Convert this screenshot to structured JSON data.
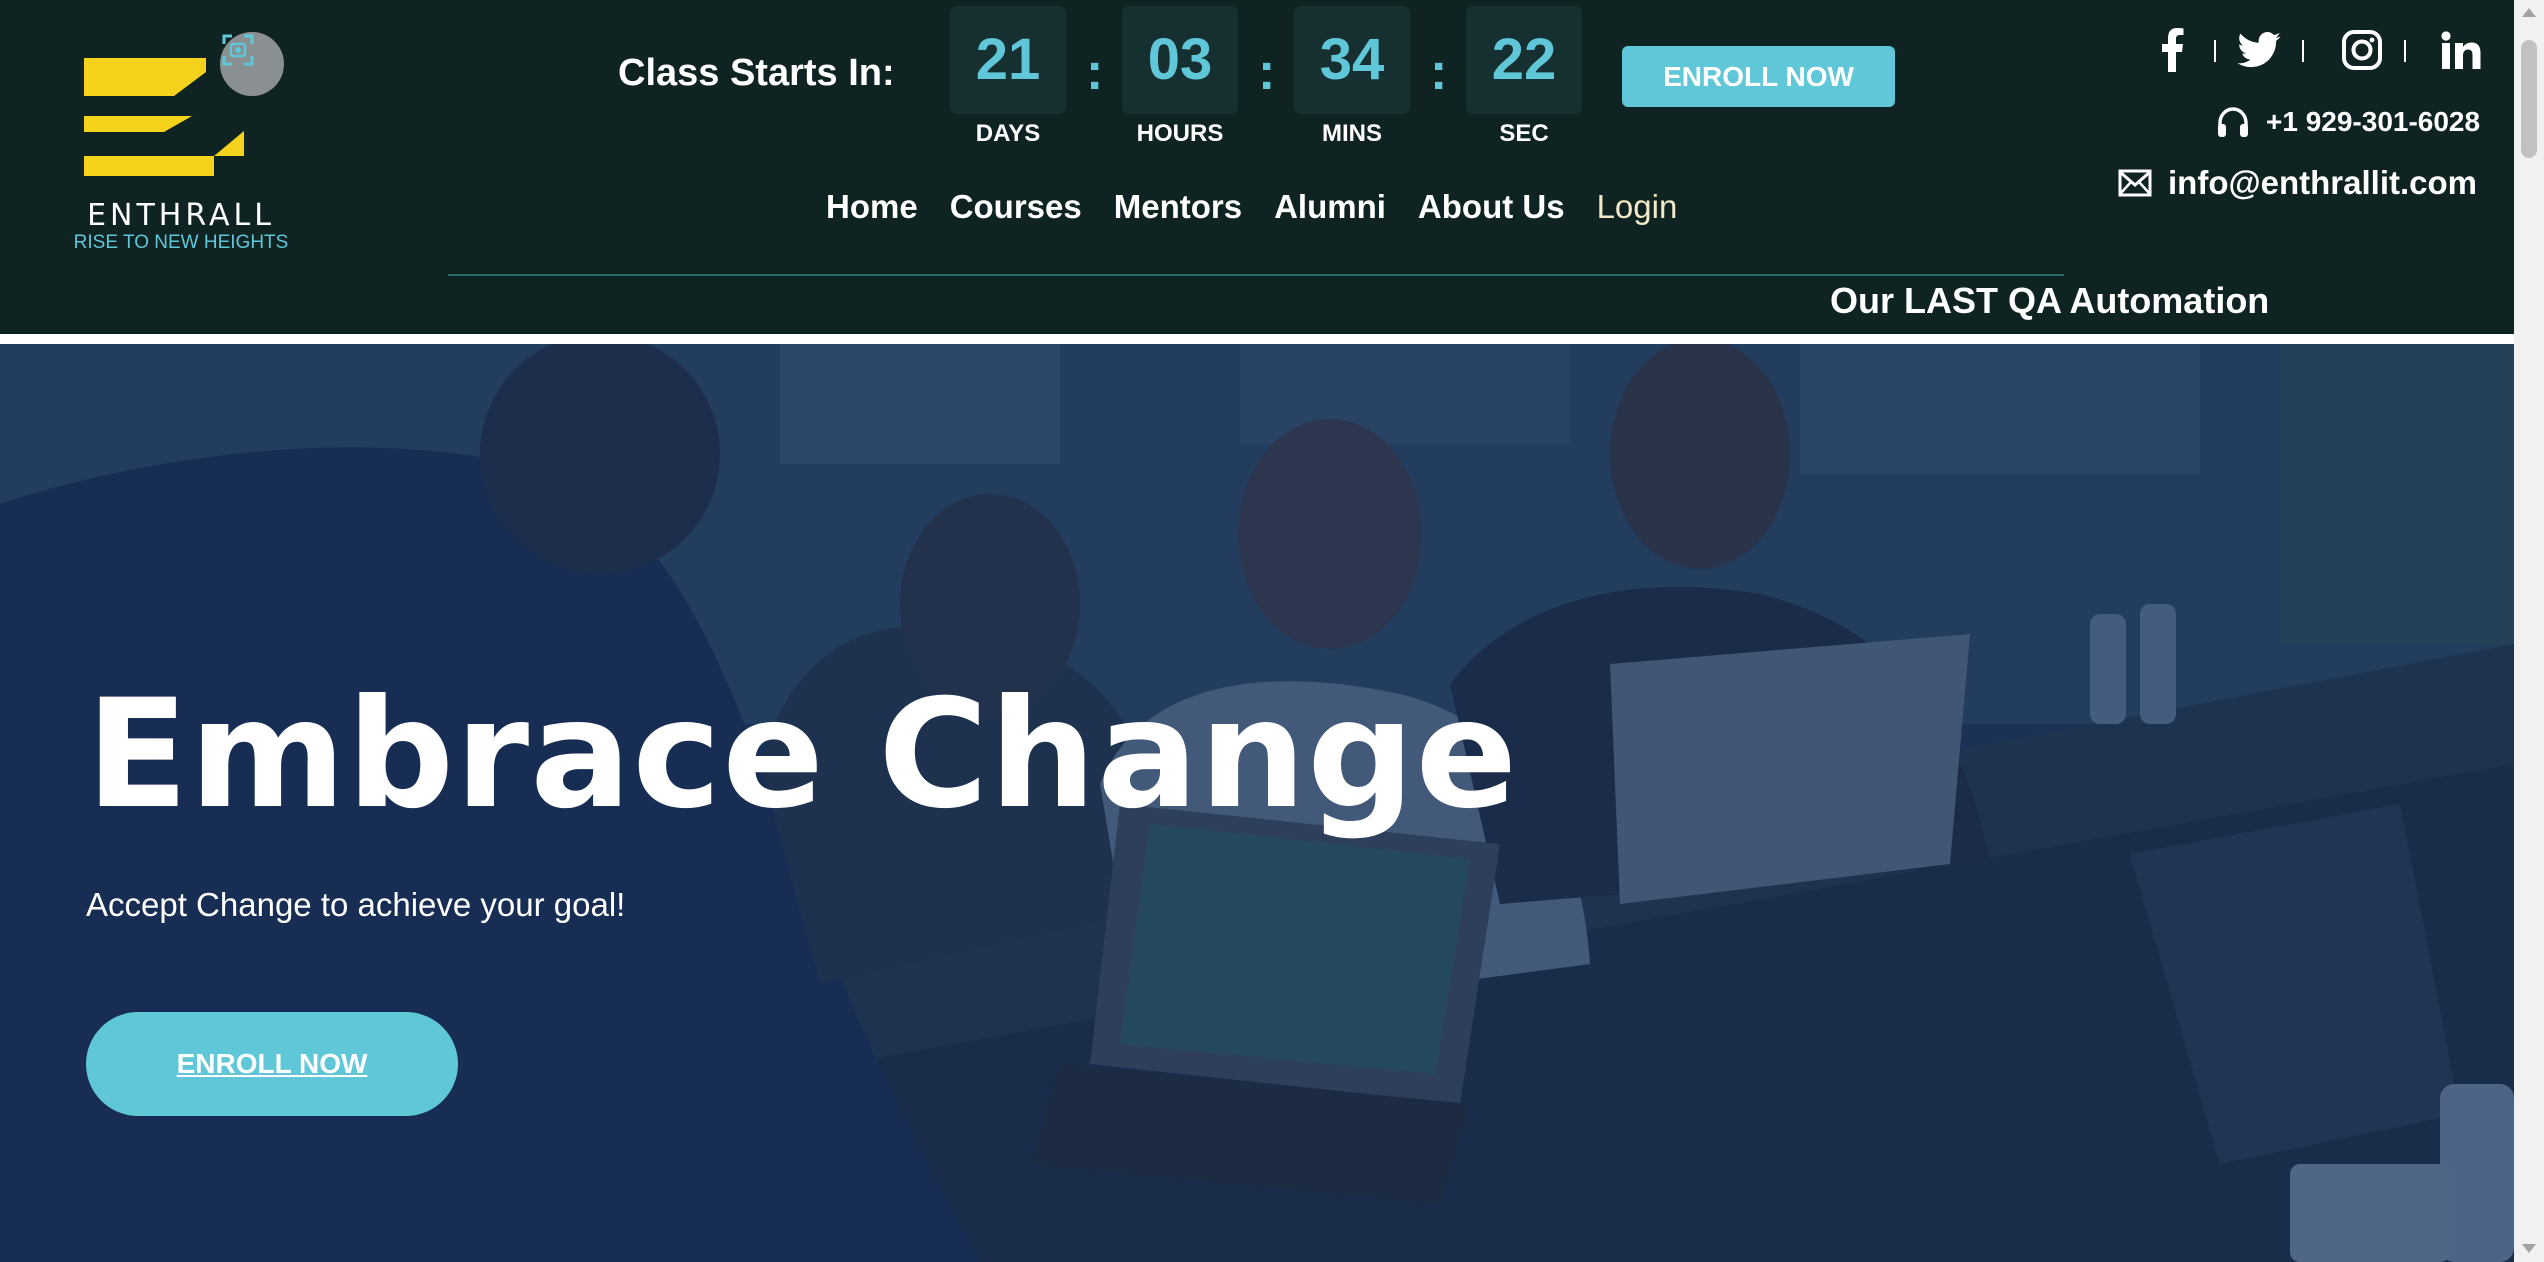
{
  "brand": {
    "name": "ENTHRALL",
    "tagline": "RISE TO NEW HEIGHTS",
    "logo_color": "#f5d21b",
    "accent": "#5fc7d8"
  },
  "countdown": {
    "label": "Class Starts In:",
    "days": "21",
    "hours": "03",
    "mins": "34",
    "sec": "22",
    "days_label": "DAYS",
    "hours_label": "HOURS",
    "mins_label": "MINS",
    "sec_label": "SEC",
    "separator": ":"
  },
  "header": {
    "enroll_label": "ENROLL NOW",
    "marquee": "Our LAST QA Automation"
  },
  "nav": {
    "items": [
      "Home",
      "Courses",
      "Mentors",
      "Alumni",
      "About Us",
      "Login"
    ]
  },
  "socials": [
    "facebook-icon",
    "twitter-icon",
    "instagram-icon",
    "linkedin-icon"
  ],
  "contact": {
    "phone": "+1 929-301-6028",
    "email": "info@enthrallit.com"
  },
  "hero": {
    "title": "Embrace Change",
    "subtitle": "Accept Change to achieve your goal!",
    "enroll_label": "ENROLL NOW"
  }
}
